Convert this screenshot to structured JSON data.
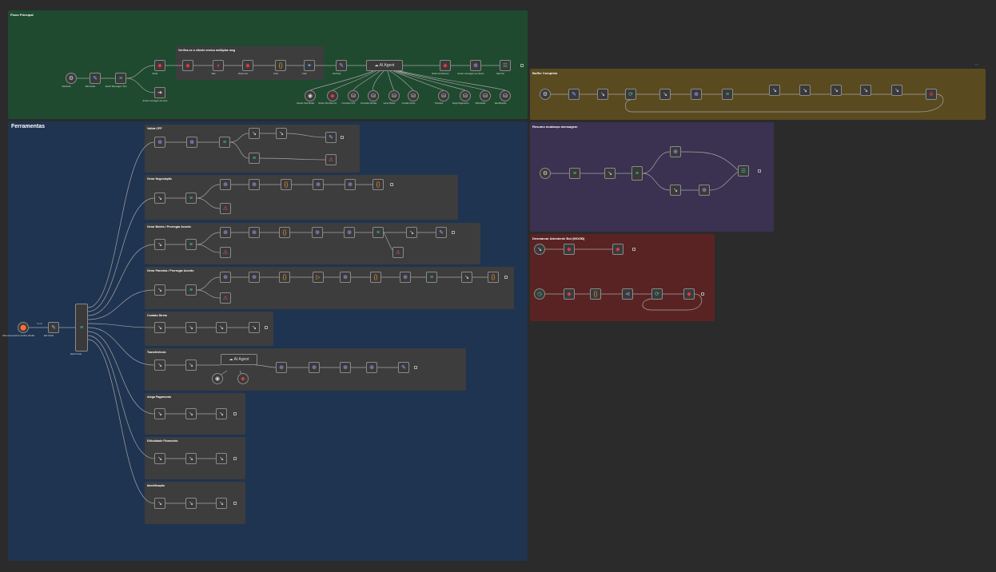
{
  "stickies": [
    {
      "id": "fluxo",
      "title": "Fluxo Principal",
      "color": "#1f4a2f"
    },
    {
      "id": "ferramentas",
      "title": "Ferramentas",
      "color": "#1f3450"
    },
    {
      "id": "buffer",
      "title": "Buffer Completo",
      "color": "#5a4a1f"
    },
    {
      "id": "resumo",
      "title": "Resumo mudança mensagem",
      "color": "#3a3250"
    },
    {
      "id": "desmarcar",
      "title": "Desmarcar Atendente Bot (MOOB)",
      "color": "#5a2323"
    }
  ],
  "groups": [
    {
      "id": "verifica",
      "title": "Verifica se o cliente enviou múltiplas msg"
    },
    {
      "id": "cpf",
      "title": "Valida CPF"
    },
    {
      "id": "agenda",
      "title": "Gerar Negociação"
    },
    {
      "id": "boleto",
      "title": "Gerar Boleto / Prorrogar Acordo"
    },
    {
      "id": "parcelas",
      "title": "Gerar Parcelas / Prorrogar Acordo"
    },
    {
      "id": "contato",
      "title": "Contato Direto"
    },
    {
      "id": "transfer",
      "title": "Transferência"
    },
    {
      "id": "pagamento",
      "title": "Alega Pagamento"
    },
    {
      "id": "dificuldade",
      "title": "Dificuldade Financeira"
    },
    {
      "id": "identificacao",
      "title": "Identificação"
    }
  ],
  "node_labels": {
    "webhook": "Webhook",
    "edit_fields": "Edit Fields",
    "switch_tipo": "Switch Mensagem Tipo",
    "redis1": "Redis",
    "redis2": "Redis",
    "get_msg": "Get Messages",
    "wait": "Wait",
    "redis_get": "Redis Get",
    "code": "Code",
    "filter": "Filter",
    "set_final": "Set Final",
    "ai_agent": "AI Agent",
    "redis_set": "Redis Set Memory",
    "http_send": "Enviar mensagem ao cliente",
    "split": "Split Out",
    "ai_tool1": "Openai Chat Model",
    "ai_tool2": "Redis Chat Memory",
    "ai_tool3": "Consultar CPF",
    "ai_tool4": "Consultar Dividas",
    "ai_tool5": "Gerar Boleto",
    "ai_tool6": "Contato Direto",
    "ai_tool7": "Transferir",
    "ai_tool8": "Alega Pagamento",
    "ai_tool9": "Dificuldade",
    "ai_tool10": "Identificação",
    "no_ops": "Enviar mensagem de texto",
    "exec_trigger": "When Executed by Another Workflow",
    "set_fer": "Edit Fields",
    "switch_fer": "Switch Tools",
    "http_req": "HTTP Request",
    "if_node": "If",
    "merge": "Merge",
    "stop": "Stop and Error"
  },
  "edge_label_tools": "Tools",
  "zoom_controls": [
    "+",
    "−"
  ]
}
